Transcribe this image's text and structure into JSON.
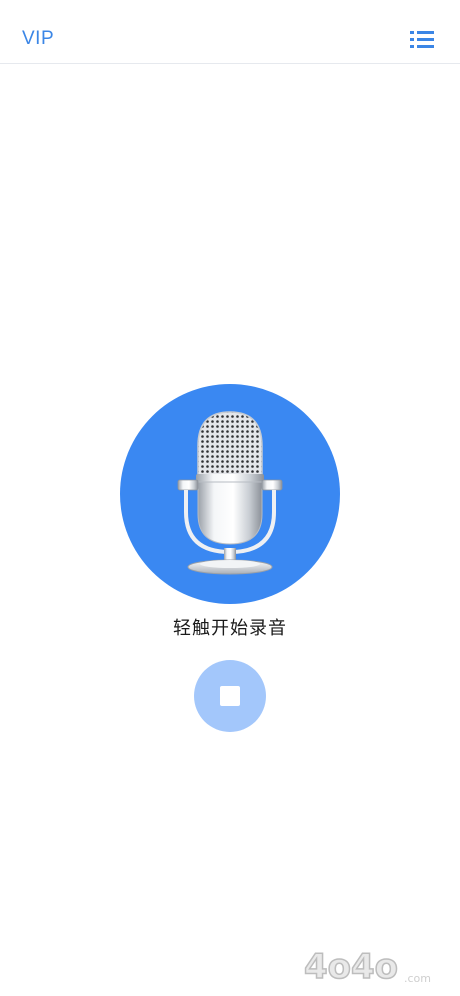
{
  "header": {
    "vip_label": "VIP",
    "menu_icon": "list-menu-icon"
  },
  "recorder": {
    "mic_icon": "microphone-icon",
    "hint": "轻触开始录音",
    "stop_icon": "stop-icon"
  },
  "watermark": {
    "text": "4o4o.com"
  },
  "colors": {
    "accent": "#3a88f2",
    "stop_bg": "#a3c7fb",
    "link": "#3b86e6"
  }
}
